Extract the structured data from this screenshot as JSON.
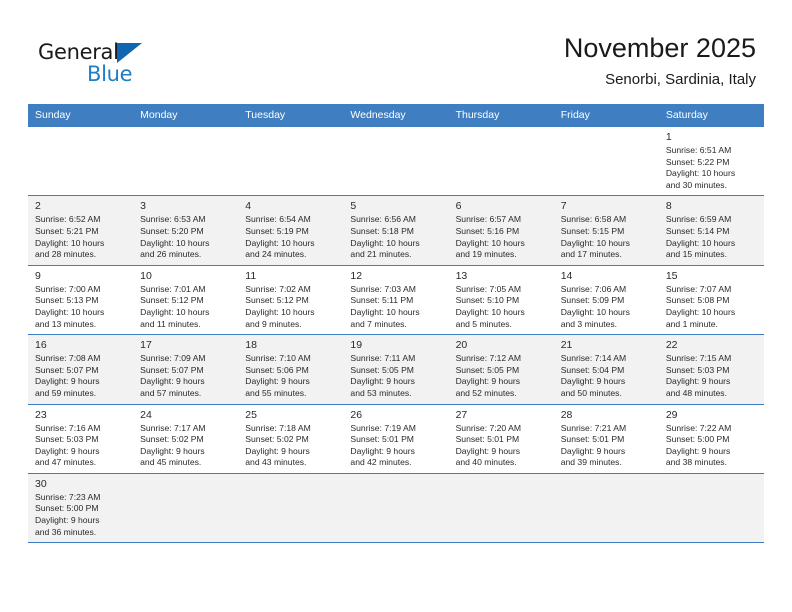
{
  "brand": {
    "name_top": "General",
    "name_bottom": "Blue",
    "accent_color": "#1f7fc4",
    "triangle_color": "#1066b0"
  },
  "header": {
    "title": "November 2025",
    "subtitle": "Senorbi, Sardinia, Italy"
  },
  "calendar": {
    "header_bg": "#3f7fc1",
    "weekdays": [
      "Sunday",
      "Monday",
      "Tuesday",
      "Wednesday",
      "Thursday",
      "Friday",
      "Saturday"
    ],
    "weeks": [
      [
        {
          "day": "",
          "sunrise": "",
          "sunset": "",
          "daylight": "",
          "empty": true
        },
        {
          "day": "",
          "sunrise": "",
          "sunset": "",
          "daylight": "",
          "empty": true
        },
        {
          "day": "",
          "sunrise": "",
          "sunset": "",
          "daylight": "",
          "empty": true
        },
        {
          "day": "",
          "sunrise": "",
          "sunset": "",
          "daylight": "",
          "empty": true
        },
        {
          "day": "",
          "sunrise": "",
          "sunset": "",
          "daylight": "",
          "empty": true
        },
        {
          "day": "",
          "sunrise": "",
          "sunset": "",
          "daylight": "",
          "empty": true
        },
        {
          "day": "1",
          "sunrise": "Sunrise: 6:51 AM",
          "sunset": "Sunset: 5:22 PM",
          "daylight": "Daylight: 10 hours",
          "daylight2": "and 30 minutes."
        }
      ],
      [
        {
          "day": "2",
          "sunrise": "Sunrise: 6:52 AM",
          "sunset": "Sunset: 5:21 PM",
          "daylight": "Daylight: 10 hours",
          "daylight2": "and 28 minutes."
        },
        {
          "day": "3",
          "sunrise": "Sunrise: 6:53 AM",
          "sunset": "Sunset: 5:20 PM",
          "daylight": "Daylight: 10 hours",
          "daylight2": "and 26 minutes."
        },
        {
          "day": "4",
          "sunrise": "Sunrise: 6:54 AM",
          "sunset": "Sunset: 5:19 PM",
          "daylight": "Daylight: 10 hours",
          "daylight2": "and 24 minutes."
        },
        {
          "day": "5",
          "sunrise": "Sunrise: 6:56 AM",
          "sunset": "Sunset: 5:18 PM",
          "daylight": "Daylight: 10 hours",
          "daylight2": "and 21 minutes."
        },
        {
          "day": "6",
          "sunrise": "Sunrise: 6:57 AM",
          "sunset": "Sunset: 5:16 PM",
          "daylight": "Daylight: 10 hours",
          "daylight2": "and 19 minutes."
        },
        {
          "day": "7",
          "sunrise": "Sunrise: 6:58 AM",
          "sunset": "Sunset: 5:15 PM",
          "daylight": "Daylight: 10 hours",
          "daylight2": "and 17 minutes."
        },
        {
          "day": "8",
          "sunrise": "Sunrise: 6:59 AM",
          "sunset": "Sunset: 5:14 PM",
          "daylight": "Daylight: 10 hours",
          "daylight2": "and 15 minutes."
        }
      ],
      [
        {
          "day": "9",
          "sunrise": "Sunrise: 7:00 AM",
          "sunset": "Sunset: 5:13 PM",
          "daylight": "Daylight: 10 hours",
          "daylight2": "and 13 minutes."
        },
        {
          "day": "10",
          "sunrise": "Sunrise: 7:01 AM",
          "sunset": "Sunset: 5:12 PM",
          "daylight": "Daylight: 10 hours",
          "daylight2": "and 11 minutes."
        },
        {
          "day": "11",
          "sunrise": "Sunrise: 7:02 AM",
          "sunset": "Sunset: 5:12 PM",
          "daylight": "Daylight: 10 hours",
          "daylight2": "and 9 minutes."
        },
        {
          "day": "12",
          "sunrise": "Sunrise: 7:03 AM",
          "sunset": "Sunset: 5:11 PM",
          "daylight": "Daylight: 10 hours",
          "daylight2": "and 7 minutes."
        },
        {
          "day": "13",
          "sunrise": "Sunrise: 7:05 AM",
          "sunset": "Sunset: 5:10 PM",
          "daylight": "Daylight: 10 hours",
          "daylight2": "and 5 minutes."
        },
        {
          "day": "14",
          "sunrise": "Sunrise: 7:06 AM",
          "sunset": "Sunset: 5:09 PM",
          "daylight": "Daylight: 10 hours",
          "daylight2": "and 3 minutes."
        },
        {
          "day": "15",
          "sunrise": "Sunrise: 7:07 AM",
          "sunset": "Sunset: 5:08 PM",
          "daylight": "Daylight: 10 hours",
          "daylight2": "and 1 minute."
        }
      ],
      [
        {
          "day": "16",
          "sunrise": "Sunrise: 7:08 AM",
          "sunset": "Sunset: 5:07 PM",
          "daylight": "Daylight: 9 hours",
          "daylight2": "and 59 minutes."
        },
        {
          "day": "17",
          "sunrise": "Sunrise: 7:09 AM",
          "sunset": "Sunset: 5:07 PM",
          "daylight": "Daylight: 9 hours",
          "daylight2": "and 57 minutes."
        },
        {
          "day": "18",
          "sunrise": "Sunrise: 7:10 AM",
          "sunset": "Sunset: 5:06 PM",
          "daylight": "Daylight: 9 hours",
          "daylight2": "and 55 minutes."
        },
        {
          "day": "19",
          "sunrise": "Sunrise: 7:11 AM",
          "sunset": "Sunset: 5:05 PM",
          "daylight": "Daylight: 9 hours",
          "daylight2": "and 53 minutes."
        },
        {
          "day": "20",
          "sunrise": "Sunrise: 7:12 AM",
          "sunset": "Sunset: 5:05 PM",
          "daylight": "Daylight: 9 hours",
          "daylight2": "and 52 minutes."
        },
        {
          "day": "21",
          "sunrise": "Sunrise: 7:14 AM",
          "sunset": "Sunset: 5:04 PM",
          "daylight": "Daylight: 9 hours",
          "daylight2": "and 50 minutes."
        },
        {
          "day": "22",
          "sunrise": "Sunrise: 7:15 AM",
          "sunset": "Sunset: 5:03 PM",
          "daylight": "Daylight: 9 hours",
          "daylight2": "and 48 minutes."
        }
      ],
      [
        {
          "day": "23",
          "sunrise": "Sunrise: 7:16 AM",
          "sunset": "Sunset: 5:03 PM",
          "daylight": "Daylight: 9 hours",
          "daylight2": "and 47 minutes."
        },
        {
          "day": "24",
          "sunrise": "Sunrise: 7:17 AM",
          "sunset": "Sunset: 5:02 PM",
          "daylight": "Daylight: 9 hours",
          "daylight2": "and 45 minutes."
        },
        {
          "day": "25",
          "sunrise": "Sunrise: 7:18 AM",
          "sunset": "Sunset: 5:02 PM",
          "daylight": "Daylight: 9 hours",
          "daylight2": "and 43 minutes."
        },
        {
          "day": "26",
          "sunrise": "Sunrise: 7:19 AM",
          "sunset": "Sunset: 5:01 PM",
          "daylight": "Daylight: 9 hours",
          "daylight2": "and 42 minutes."
        },
        {
          "day": "27",
          "sunrise": "Sunrise: 7:20 AM",
          "sunset": "Sunset: 5:01 PM",
          "daylight": "Daylight: 9 hours",
          "daylight2": "and 40 minutes."
        },
        {
          "day": "28",
          "sunrise": "Sunrise: 7:21 AM",
          "sunset": "Sunset: 5:01 PM",
          "daylight": "Daylight: 9 hours",
          "daylight2": "and 39 minutes."
        },
        {
          "day": "29",
          "sunrise": "Sunrise: 7:22 AM",
          "sunset": "Sunset: 5:00 PM",
          "daylight": "Daylight: 9 hours",
          "daylight2": "and 38 minutes."
        }
      ],
      [
        {
          "day": "30",
          "sunrise": "Sunrise: 7:23 AM",
          "sunset": "Sunset: 5:00 PM",
          "daylight": "Daylight: 9 hours",
          "daylight2": "and 36 minutes."
        },
        {
          "day": "",
          "sunrise": "",
          "sunset": "",
          "daylight": "",
          "empty": true
        },
        {
          "day": "",
          "sunrise": "",
          "sunset": "",
          "daylight": "",
          "empty": true
        },
        {
          "day": "",
          "sunrise": "",
          "sunset": "",
          "daylight": "",
          "empty": true
        },
        {
          "day": "",
          "sunrise": "",
          "sunset": "",
          "daylight": "",
          "empty": true
        },
        {
          "day": "",
          "sunrise": "",
          "sunset": "",
          "daylight": "",
          "empty": true
        },
        {
          "day": "",
          "sunrise": "",
          "sunset": "",
          "daylight": "",
          "empty": true
        }
      ]
    ]
  }
}
